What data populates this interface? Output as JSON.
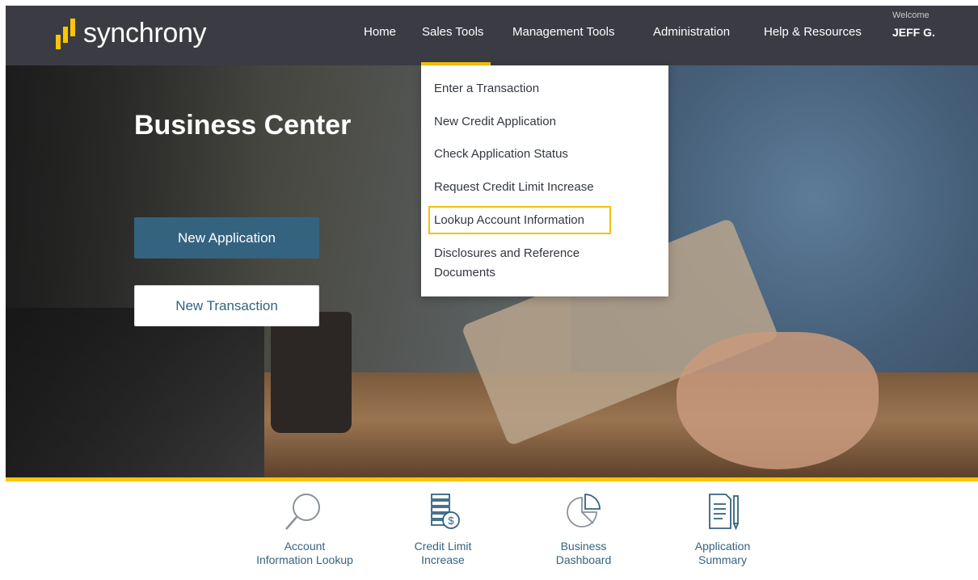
{
  "brand": {
    "name": "synchrony",
    "accent": "#fbc600",
    "header_bg": "#3b3c43",
    "primary": "#34637f"
  },
  "nav": {
    "items": [
      {
        "label": "Home"
      },
      {
        "label": "Sales Tools"
      },
      {
        "label": "Management Tools"
      },
      {
        "label": "Administration"
      },
      {
        "label": "Help & Resources"
      }
    ],
    "active_item": "Sales Tools"
  },
  "user": {
    "welcome": "Welcome",
    "name": "JEFF G."
  },
  "hero": {
    "title": "Business Center",
    "primary_button": "New Application",
    "secondary_button": "New Transaction"
  },
  "dropdown": {
    "items": [
      {
        "label": "Enter a Transaction"
      },
      {
        "label": "New Credit Application"
      },
      {
        "label": "Check Application Status"
      },
      {
        "label": "Request Credit Limit Increase"
      },
      {
        "label": "Lookup Account Information",
        "highlighted": true
      },
      {
        "label": "Disclosures and Reference",
        "label2": "Documents"
      }
    ]
  },
  "quick_links": [
    {
      "icon": "magnifier-icon",
      "line1": "Account",
      "line2": "Information Lookup"
    },
    {
      "icon": "money-stack-icon",
      "line1": "Credit Limit",
      "line2": "Increase"
    },
    {
      "icon": "pie-chart-icon",
      "line1": "Business",
      "line2": "Dashboard"
    },
    {
      "icon": "document-pen-icon",
      "line1": "Application",
      "line2": "Summary"
    }
  ]
}
